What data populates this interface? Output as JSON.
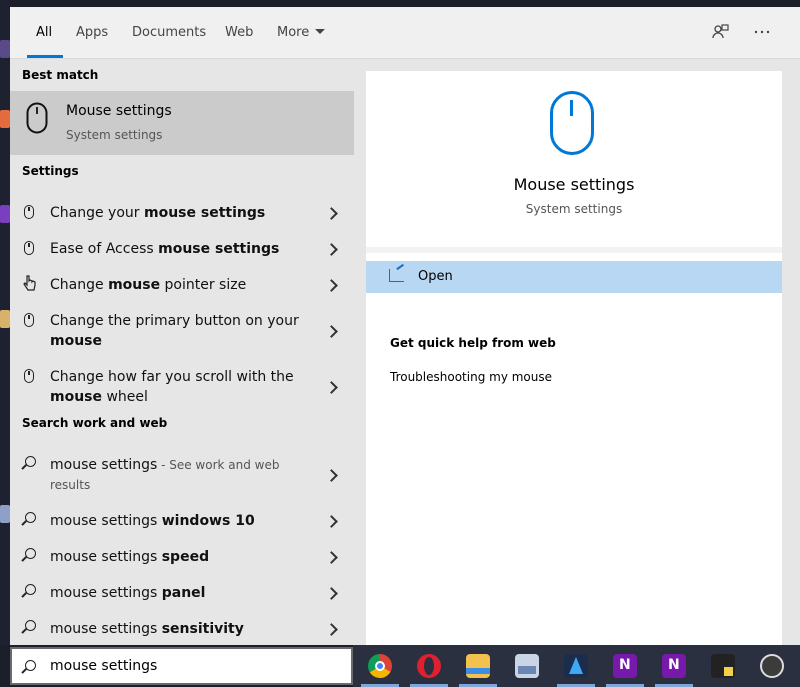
{
  "tabs": [
    {
      "label": "All",
      "active": true
    },
    {
      "label": "Apps"
    },
    {
      "label": "Documents"
    },
    {
      "label": "Web"
    },
    {
      "label": "More"
    }
  ],
  "topbar_icons": [
    "feedback-icon",
    "more-options-icon"
  ],
  "best_match": {
    "heading": "Best match",
    "title": "Mouse settings",
    "subtitle": "System settings"
  },
  "settings": {
    "heading": "Settings",
    "items": [
      {
        "pre": "Change your ",
        "bold": "mouse settings",
        "post": ""
      },
      {
        "pre": "Ease of Access ",
        "bold": "mouse settings",
        "post": ""
      },
      {
        "pre": "Change ",
        "bold": "mouse",
        "post": " pointer size"
      },
      {
        "line1": "Change the primary button on your",
        "line2_bold": "mouse",
        "line2_post": ""
      },
      {
        "line1": "Change how far you scroll with the",
        "line2_bold": "mouse",
        "line2_post": " wheel"
      }
    ]
  },
  "search_web": {
    "heading": "Search work and web",
    "items": [
      {
        "pre": "mouse settings",
        "hint": " - See work and web",
        "hint2": "results"
      },
      {
        "pre": "mouse settings ",
        "bold": "windows 10"
      },
      {
        "pre": "mouse settings ",
        "bold": "speed"
      },
      {
        "pre": "mouse settings ",
        "bold": "panel"
      },
      {
        "pre": "mouse settings ",
        "bold": "sensitivity"
      }
    ]
  },
  "preview": {
    "title": "Mouse settings",
    "subtitle": "System settings",
    "open_label": "Open",
    "quick_help_heading": "Get quick help from web",
    "quick_help_link": "Troubleshooting my mouse"
  },
  "search": {
    "value": "mouse settings"
  },
  "taskbar": {
    "icons": [
      "chrome-icon",
      "opera-icon",
      "file-explorer-icon",
      "image-viewer-icon",
      "affinity-designer-icon",
      "onenote-icon",
      "onenote-2-icon",
      "sticky-notes-icon",
      "app-icon"
    ]
  },
  "colors": {
    "accent": "#0078d7",
    "highlight": "#b7d7f3",
    "selected": "#cbcbcb"
  }
}
